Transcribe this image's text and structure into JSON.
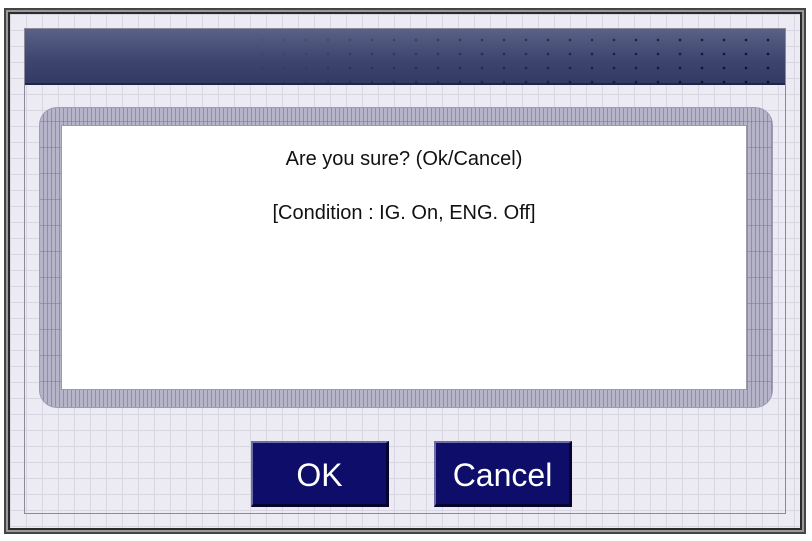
{
  "dialog": {
    "title": "",
    "message_line1": "Are you sure? (Ok/Cancel)",
    "message_line2": "[Condition : IG. On, ENG. Off]"
  },
  "buttons": {
    "ok_label": "OK",
    "cancel_label": "Cancel"
  },
  "colors": {
    "titlebar": "#3e4670",
    "button_bg": "#0e0e6a",
    "button_text": "#ffffff",
    "background": "#eceaf3",
    "message_bg": "#ffffff"
  }
}
